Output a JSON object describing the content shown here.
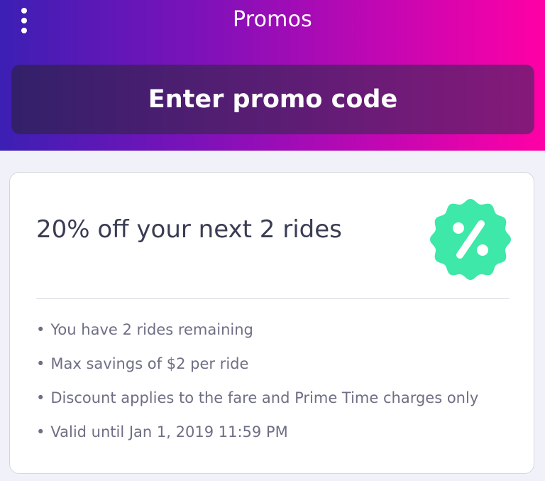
{
  "header": {
    "title": "Promos",
    "menu_icon": "more-vertical-icon",
    "enter_promo_label": "Enter promo code"
  },
  "promo": {
    "title": "20% off your next 2 rides",
    "badge_icon": "percent-badge-icon",
    "badge_color": "#3de8a8",
    "details": [
      "You have 2 rides remaining",
      "Max savings of $2 per ride",
      "Discount applies to the fare and Prime Time charges only",
      "Valid until Jan 1, 2019 11:59 PM"
    ]
  }
}
